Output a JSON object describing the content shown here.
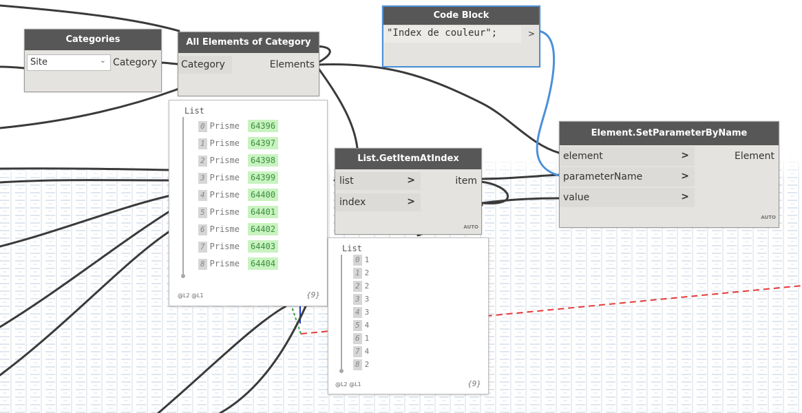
{
  "nodes": {
    "categories": {
      "title": "Categories",
      "dropdown_value": "Site",
      "output": "Category"
    },
    "all_elements": {
      "title": "All Elements of Category",
      "input": "Category",
      "output": "Elements"
    },
    "code_block": {
      "title": "Code Block",
      "code": "\"Index de couleur\";",
      "output_arrow": ">"
    },
    "set_param": {
      "title": "Element.SetParameterByName",
      "inputs": [
        "element",
        "parameterName",
        "value"
      ],
      "output": "Element",
      "lacing": "AUTO"
    },
    "get_item": {
      "title": "List.GetItemAtIndex",
      "inputs": [
        "list",
        "index"
      ],
      "output": "item",
      "lacing": "AUTO"
    }
  },
  "previews": {
    "elements": {
      "title": "List",
      "items": [
        {
          "index": "0",
          "type": "Prisme",
          "id": "64396"
        },
        {
          "index": "1",
          "type": "Prisme",
          "id": "64397"
        },
        {
          "index": "2",
          "type": "Prisme",
          "id": "64398"
        },
        {
          "index": "3",
          "type": "Prisme",
          "id": "64399"
        },
        {
          "index": "4",
          "type": "Prisme",
          "id": "64400"
        },
        {
          "index": "5",
          "type": "Prisme",
          "id": "64401"
        },
        {
          "index": "6",
          "type": "Prisme",
          "id": "64402"
        },
        {
          "index": "7",
          "type": "Prisme",
          "id": "64403"
        },
        {
          "index": "8",
          "type": "Prisme",
          "id": "64404"
        }
      ],
      "levels": "@L2 @L1",
      "count": "{9}"
    },
    "get_item": {
      "title": "List",
      "items": [
        {
          "index": "0",
          "value": "1"
        },
        {
          "index": "1",
          "value": "2"
        },
        {
          "index": "2",
          "value": "2"
        },
        {
          "index": "3",
          "value": "3"
        },
        {
          "index": "4",
          "value": "3"
        },
        {
          "index": "5",
          "value": "4"
        },
        {
          "index": "6",
          "value": "1"
        },
        {
          "index": "7",
          "value": "4"
        },
        {
          "index": "8",
          "value": "2"
        }
      ],
      "levels": "@L2 @L1",
      "count": "{9}"
    }
  },
  "colors": {
    "node_header": "#575757",
    "node_body": "#e4e3df",
    "wire": "#3a3a3a",
    "wire_selected": "#4a90d9",
    "code_block_border": "#4a90d9",
    "axis_x": "#e53935",
    "axis_y": "#43a047",
    "axis_z": "#1e3cc8"
  }
}
